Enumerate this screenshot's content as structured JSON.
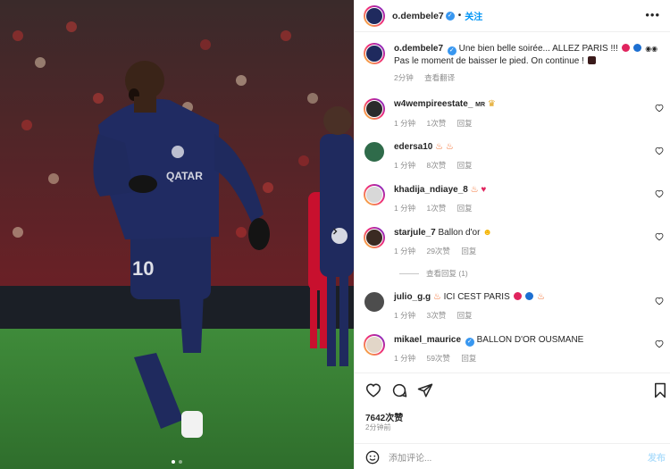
{
  "post": {
    "username": "o.dembele7",
    "follow_label": "关注",
    "more_icon": "more-horizontal-icon"
  },
  "caption": {
    "username": "o.dembele7",
    "text_line1": "Une bien belle soirée... ALLEZ PARIS !!!",
    "text_line2": "Pas le moment de baisser le pied. On continue !",
    "time": "2分钟",
    "translate_label": "查看翻译"
  },
  "comments": [
    {
      "username": "w4wempireestate_",
      "badge": "MR",
      "text": "",
      "time": "1 分钟",
      "likes": "1次赞",
      "reply": "回复"
    },
    {
      "username": "edersa10",
      "text": "",
      "time": "1 分钟",
      "likes": "8次赞",
      "reply": "回复"
    },
    {
      "username": "khadija_ndiaye_8",
      "text": "",
      "time": "1 分钟",
      "likes": "1次赞",
      "reply": "回复"
    },
    {
      "username": "starjule_7",
      "text": "Ballon d'or",
      "time": "1 分钟",
      "likes": "29次赞",
      "reply": "回复"
    },
    {
      "username": "julio_g.g",
      "text": "ICI CEST PARIS",
      "time": "1 分钟",
      "likes": "3次赞",
      "reply": "回复"
    },
    {
      "username": "mikael_maurice",
      "text": "BALLON D'OR OUSMANE",
      "time": "1 分钟",
      "likes": "59次赞",
      "reply": "回复"
    }
  ],
  "view_replies_label": "查看回复 (1)",
  "likes_count": "7642次赞",
  "posted_ago": "2分钟前",
  "comment_input": {
    "placeholder": "添加评论...",
    "post_label": "发布"
  },
  "carousel": {
    "current": 1,
    "total": 2
  },
  "colors": {
    "accent": "#0095f6",
    "verified": "#3897f0",
    "jersey": "#1f2a5e",
    "pitch": "#3e8f3a"
  }
}
